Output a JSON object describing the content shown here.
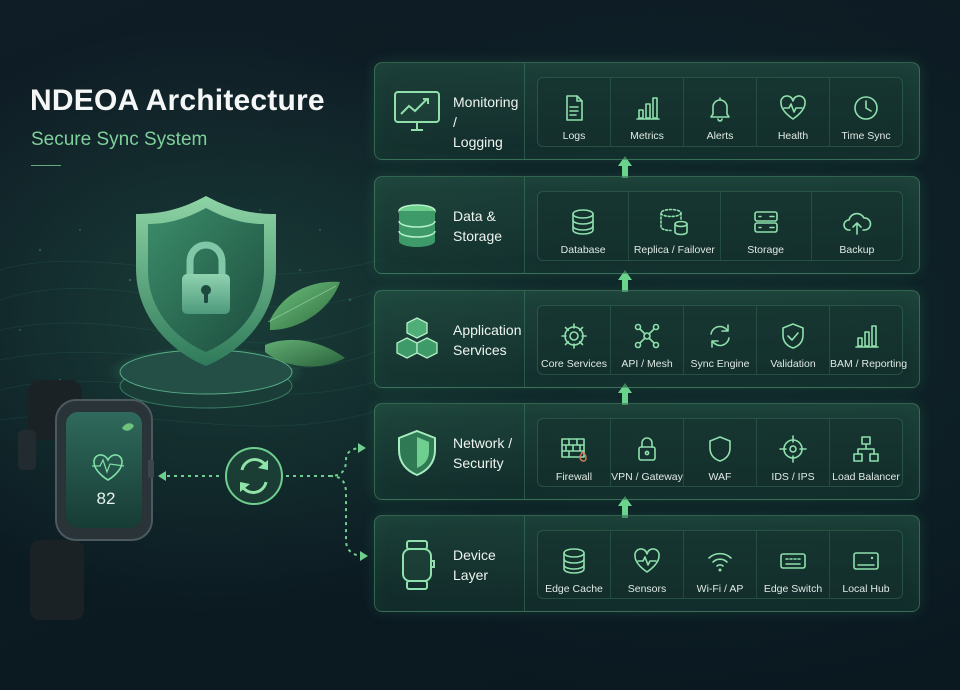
{
  "header": {
    "title": "NDEOA Architecture",
    "subtitle": "Secure Sync System"
  },
  "watch": {
    "reading": "82"
  },
  "colors": {
    "accent": "#6fcf8f",
    "panel_border": "#6ec896",
    "bg": "#0c1a22"
  },
  "layers": [
    {
      "name": "Monitoring / Logging",
      "label_lines": [
        "Monitoring /",
        "Logging"
      ],
      "icon": "monitor-chart-icon",
      "items": [
        {
          "label": "Logs",
          "icon": "document-icon"
        },
        {
          "label": "Metrics",
          "icon": "bar-chart-icon"
        },
        {
          "label": "Alerts",
          "icon": "bell-icon"
        },
        {
          "label": "Health",
          "icon": "heartbeat-icon"
        },
        {
          "label": "Time Sync",
          "icon": "clock-icon"
        }
      ]
    },
    {
      "name": "Data & Storage",
      "label_lines": [
        "Data &",
        "Storage"
      ],
      "icon": "database-icon",
      "items": [
        {
          "label": "Database",
          "icon": "database-icon"
        },
        {
          "label": "Replica / Failover",
          "icon": "replica-database-icon"
        },
        {
          "label": "Storage",
          "icon": "server-storage-icon"
        },
        {
          "label": "Backup",
          "icon": "cloud-upload-icon"
        }
      ]
    },
    {
      "name": "Application Services",
      "label_lines": [
        "Application",
        "Services"
      ],
      "icon": "cubes-icon",
      "items": [
        {
          "label": "Core Services",
          "icon": "gear-icon"
        },
        {
          "label": "API / Mesh",
          "icon": "mesh-network-icon"
        },
        {
          "label": "Sync Engine",
          "icon": "sync-icon"
        },
        {
          "label": "Validation",
          "icon": "shield-check-icon"
        },
        {
          "label": "BAM / Reporting",
          "icon": "bar-chart-icon"
        }
      ]
    },
    {
      "name": "Network / Security",
      "label_lines": [
        "Network /",
        "Security"
      ],
      "icon": "shield-icon",
      "items": [
        {
          "label": "Firewall",
          "icon": "firewall-icon"
        },
        {
          "label": "VPN / Gateway",
          "icon": "lock-icon"
        },
        {
          "label": "WAF",
          "icon": "shield-outline-icon"
        },
        {
          "label": "IDS / IPS",
          "icon": "crosshair-icon"
        },
        {
          "label": "Load Balancer",
          "icon": "hierarchy-icon"
        }
      ]
    },
    {
      "name": "Device Layer",
      "label_lines": [
        "Device",
        "Layer"
      ],
      "icon": "smartwatch-icon",
      "items": [
        {
          "label": "Edge Cache",
          "icon": "database-icon"
        },
        {
          "label": "Sensors",
          "icon": "heartbeat-icon"
        },
        {
          "label": "Wi-Fi / AP",
          "icon": "wifi-icon"
        },
        {
          "label": "Edge Switch",
          "icon": "switch-icon"
        },
        {
          "label": "Local Hub",
          "icon": "hub-icon"
        }
      ]
    }
  ]
}
